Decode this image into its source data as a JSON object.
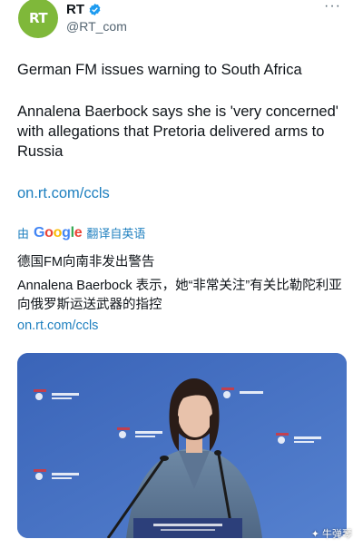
{
  "account": {
    "display_name": "RT",
    "handle": "@RT_com",
    "avatar_text": "RT"
  },
  "tweet": {
    "headline": "German FM issues warning to South Africa",
    "body": "Annalena Baerbock says she is 'very concerned' with allegations that Pretoria delivered arms to Russia",
    "link": "on.rt.com/ccls"
  },
  "translation": {
    "prefix": "由",
    "provider": "Google",
    "suffix": "翻译自英语",
    "headline": "德国FM向南非发出警告",
    "body": "Annalena Baerbock 表示，她“非常关注”有关比勒陀利亚向俄罗斯运送武器的指控",
    "link": "on.rt.com/ccls"
  },
  "photo": {
    "backdrop_logos": [
      "Munich Group",
      "Munich Group",
      "Munich Group",
      "Munich Group",
      "Munich Group"
    ]
  },
  "watermark": {
    "text": "牛弹琴"
  },
  "colors": {
    "link": "#1d7fbf",
    "avatar": "#7fb83a",
    "verified": "#1d9bf0",
    "photo_bg": "#4470c2"
  }
}
